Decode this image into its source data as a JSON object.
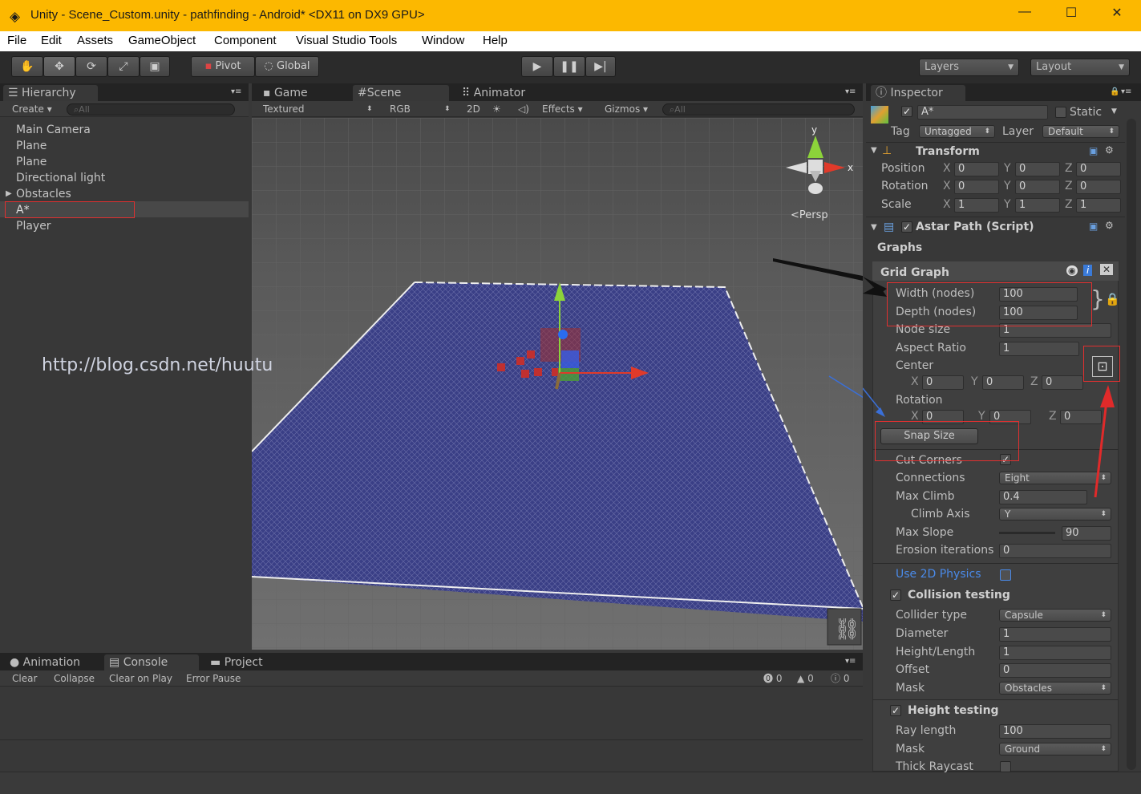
{
  "window": {
    "title": "Unity - Scene_Custom.unity - pathfinding - Android* <DX11 on DX9 GPU>",
    "minimize": "—",
    "maximize": "☐",
    "close": "✕"
  },
  "menu": [
    "File",
    "Edit",
    "Assets",
    "GameObject",
    "Component",
    "Visual Studio Tools",
    "Window",
    "Help"
  ],
  "toolbar": {
    "tools": [
      "hand-icon",
      "move-icon",
      "rotate-icon",
      "scale-icon",
      "rect-icon"
    ],
    "pivot": "Pivot",
    "global": "Global",
    "layers": "Layers",
    "layout": "Layout"
  },
  "hierarchy": {
    "tab": "Hierarchy",
    "create": "Create",
    "search_placeholder": "All",
    "items": [
      "Main Camera",
      "Plane",
      "Plane",
      "Directional light",
      "Obstacles",
      "A*",
      "Player"
    ],
    "selected_index": 5
  },
  "scene": {
    "tabs": [
      "Game",
      "Scene",
      "Animator"
    ],
    "active_tab": "Scene",
    "shading": "Textured",
    "channel": "RGB",
    "mode2d": "2D",
    "effects": "Effects",
    "gizmos": "Gizmos",
    "search_placeholder": "All",
    "persp": "Persp",
    "watermark": "http://blog.csdn.net/huutu",
    "gizmo_axes": {
      "y": "y",
      "x": "x"
    }
  },
  "console": {
    "tabs": [
      "Animation",
      "Console",
      "Project"
    ],
    "active_tab": "Console",
    "buttons": [
      "Clear",
      "Collapse",
      "Clear on Play",
      "Error Pause"
    ],
    "counts": {
      "errors": "0",
      "warnings": "0",
      "messages": "0"
    }
  },
  "inspector": {
    "tab": "Inspector",
    "object_name": "A*",
    "static": "Static",
    "tag_label": "Tag",
    "tag": "Untagged",
    "layer_label": "Layer",
    "layer": "Default",
    "transform": {
      "title": "Transform",
      "rows": [
        {
          "label": "Position",
          "x": "0",
          "y": "0",
          "z": "0"
        },
        {
          "label": "Rotation",
          "x": "0",
          "y": "0",
          "z": "0"
        },
        {
          "label": "Scale",
          "x": "1",
          "y": "1",
          "z": "1"
        }
      ]
    },
    "script": {
      "title": "Astar Path (Script)",
      "graphs": "Graphs",
      "grid_graph": "Grid Graph",
      "width_label": "Width (nodes)",
      "width": "100",
      "depth_label": "Depth (nodes)",
      "depth": "100",
      "node_size_label": "Node size",
      "node_size": "1",
      "aspect_label": "Aspect Ratio",
      "aspect": "1",
      "center_label": "Center",
      "center": {
        "x": "0",
        "y": "0",
        "z": "0"
      },
      "rotation_label": "Rotation",
      "rotation": {
        "x": "0",
        "y": "0",
        "z": "0"
      },
      "snap_size": "Snap Size",
      "cut_corners_label": "Cut Corners",
      "connections_label": "Connections",
      "connections": "Eight",
      "max_climb_label": "Max Climb",
      "max_climb": "0.4",
      "climb_axis_label": "Climb Axis",
      "climb_axis": "Y",
      "max_slope_label": "Max Slope",
      "max_slope": "90",
      "erosion_label": "Erosion iterations",
      "erosion": "0",
      "use2d_label": "Use 2D Physics",
      "collision_label": "Collision testing",
      "collider_type_label": "Collider type",
      "collider_type": "Capsule",
      "diameter_label": "Diameter",
      "diameter": "1",
      "height_length_label": "Height/Length",
      "height_length": "1",
      "offset_label": "Offset",
      "offset": "0",
      "mask_label": "Mask",
      "mask": "Obstacles",
      "height_testing_label": "Height testing",
      "ray_length_label": "Ray length",
      "ray_length": "100",
      "mask2_label": "Mask",
      "mask2": "Ground",
      "thick_raycast_label": "Thick Raycast"
    }
  },
  "axis_letters": {
    "x": "X",
    "y": "Y",
    "z": "Z"
  },
  "colors": {
    "titlebar": "#fcb800",
    "grid_fill": "#3a3f86",
    "highlight": "#e03030",
    "arrow_black": "#111111",
    "arrow_blue": "#3a6fd8"
  }
}
